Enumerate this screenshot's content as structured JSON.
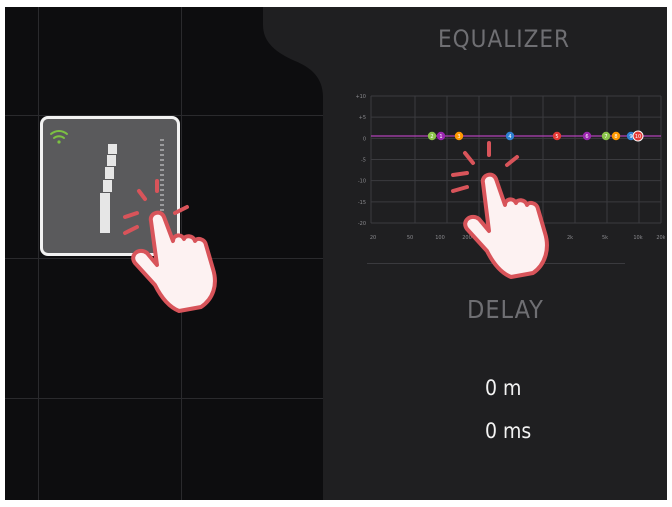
{
  "equalizer": {
    "title": "EQUALIZER",
    "y_axis_labels": [
      "+10",
      "+5",
      "0",
      "-5",
      "-10",
      "-15",
      "-20"
    ],
    "x_axis_labels": [
      "20",
      "50",
      "100",
      "200",
      "500",
      "1k",
      "2k",
      "5k",
      "10k",
      "20k"
    ],
    "bands": [
      {
        "label": "2",
        "color": "#8bc34a"
      },
      {
        "label": "1",
        "color": "#9c27b0"
      },
      {
        "label": "3",
        "color": "#ff9800"
      },
      {
        "label": "4",
        "color": "#2f80d1"
      },
      {
        "label": "5",
        "color": "#e53935"
      },
      {
        "label": "6",
        "color": "#9c27b0"
      },
      {
        "label": "7",
        "color": "#8bc34a"
      },
      {
        "label": "8",
        "color": "#ff9800"
      },
      {
        "label": "9",
        "color": "#2f80d1"
      },
      {
        "label": "10",
        "color": "#e53935"
      }
    ]
  },
  "delay": {
    "title": "DELAY",
    "meters": "0 m",
    "milliseconds": "0 ms"
  },
  "device": {
    "wifi_color": "#7cc142"
  }
}
